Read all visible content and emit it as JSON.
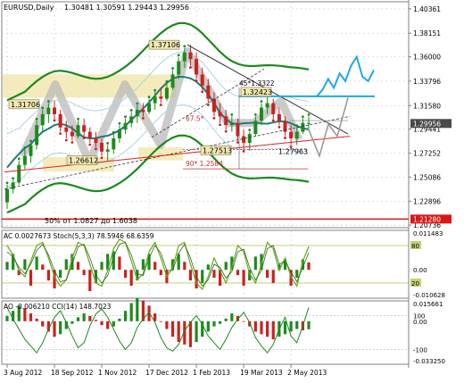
{
  "header": {
    "title": "EURUSD,Daily",
    "ohlc": "1.30481 1.30591 1.29443 1.29956"
  },
  "colors": {
    "background": "#ffffff",
    "grid": "#c0c0c0",
    "bull_candle": "#1e8a1e",
    "bear_candle": "#cc2020",
    "moving_average": "#1f7a78",
    "bollinger_outer": "#1a8a1a",
    "bollinger_inner": "#a8d4e8",
    "forecast": "#1ea9e6",
    "level_line": "#d81818",
    "support_line": "#e02020",
    "label_box": "#f2e7b0",
    "price_box": "#4a4a4a",
    "stoch_main": "#6aa619"
  },
  "annotations": {
    "level_high": "1.37106",
    "level_1_3170": "1.31706",
    "level_1_3242": "1.32423",
    "level_1_2661": "1.26612",
    "level_1_2751": "1.27513",
    "level_1_2796": "1.27963",
    "fib_45": "45*1.3322",
    "fib_67": "67.5*",
    "fib_90": "90* 1.2584",
    "fib_50": "50% от 1.0827 до 1.6038"
  },
  "chart_data": [
    {
      "type": "candlestick",
      "name": "EURUSD,Daily",
      "x_dates": [
        "3 Aug 2012",
        "18 Sep 2012",
        "1 Nov 2012",
        "17 Dec 2012",
        "1 Feb 2013",
        "19 Mar 2013",
        "2 May 2013"
      ],
      "ohlc": [
        [
          1.228,
          1.244,
          1.222,
          1.24
        ],
        [
          1.24,
          1.248,
          1.236,
          1.246
        ],
        [
          1.246,
          1.266,
          1.244,
          1.262
        ],
        [
          1.262,
          1.276,
          1.258,
          1.27
        ],
        [
          1.27,
          1.282,
          1.264,
          1.28
        ],
        [
          1.28,
          1.302,
          1.276,
          1.298
        ],
        [
          1.298,
          1.312,
          1.292,
          1.308
        ],
        [
          1.308,
          1.318,
          1.3,
          1.314
        ],
        [
          1.314,
          1.32,
          1.304,
          1.308
        ],
        [
          1.308,
          1.312,
          1.292,
          1.296
        ],
        [
          1.296,
          1.302,
          1.286,
          1.292
        ],
        [
          1.292,
          1.298,
          1.284,
          1.288
        ],
        [
          1.288,
          1.302,
          1.286,
          1.298
        ],
        [
          1.298,
          1.304,
          1.288,
          1.292
        ],
        [
          1.292,
          1.296,
          1.282,
          1.286
        ],
        [
          1.286,
          1.292,
          1.278,
          1.282
        ],
        [
          1.282,
          1.286,
          1.27,
          1.274
        ],
        [
          1.274,
          1.28,
          1.266,
          1.276
        ],
        [
          1.276,
          1.29,
          1.272,
          1.286
        ],
        [
          1.286,
          1.298,
          1.282,
          1.294
        ],
        [
          1.294,
          1.304,
          1.29,
          1.3
        ],
        [
          1.3,
          1.31,
          1.296,
          1.306
        ],
        [
          1.306,
          1.316,
          1.3,
          1.312
        ],
        [
          1.312,
          1.318,
          1.306,
          1.31
        ],
        [
          1.31,
          1.322,
          1.308,
          1.318
        ],
        [
          1.318,
          1.328,
          1.312,
          1.324
        ],
        [
          1.324,
          1.332,
          1.318,
          1.322
        ],
        [
          1.322,
          1.336,
          1.32,
          1.332
        ],
        [
          1.332,
          1.348,
          1.33,
          1.344
        ],
        [
          1.344,
          1.36,
          1.34,
          1.356
        ],
        [
          1.356,
          1.368,
          1.35,
          1.364
        ],
        [
          1.364,
          1.371,
          1.352,
          1.358
        ],
        [
          1.358,
          1.364,
          1.34,
          1.344
        ],
        [
          1.344,
          1.35,
          1.33,
          1.334
        ],
        [
          1.334,
          1.34,
          1.318,
          1.322
        ],
        [
          1.322,
          1.328,
          1.306,
          1.31
        ],
        [
          1.31,
          1.318,
          1.3,
          1.306
        ],
        [
          1.306,
          1.312,
          1.294,
          1.298
        ],
        [
          1.298,
          1.306,
          1.292,
          1.3
        ],
        [
          1.3,
          1.304,
          1.284,
          1.288
        ],
        [
          1.288,
          1.294,
          1.276,
          1.282
        ],
        [
          1.282,
          1.292,
          1.275,
          1.29
        ],
        [
          1.29,
          1.306,
          1.288,
          1.302
        ],
        [
          1.302,
          1.318,
          1.298,
          1.314
        ],
        [
          1.314,
          1.324,
          1.308,
          1.318
        ],
        [
          1.318,
          1.322,
          1.304,
          1.308
        ],
        [
          1.308,
          1.314,
          1.298,
          1.302
        ],
        [
          1.302,
          1.306,
          1.288,
          1.292
        ],
        [
          1.292,
          1.298,
          1.28,
          1.286
        ],
        [
          1.286,
          1.296,
          1.28,
          1.292
        ],
        [
          1.292,
          1.304,
          1.29,
          1.3
        ],
        [
          1.3,
          1.306,
          1.294,
          1.3
        ]
      ],
      "overlays": [
        {
          "name": "moving average",
          "color": "#1f7a78"
        },
        {
          "name": "bollinger outer",
          "color": "#1a8a1a"
        },
        {
          "name": "bollinger inner",
          "color": "#a8d4e8"
        },
        {
          "name": "forecast",
          "color": "#1ea9e6",
          "values": [
            1.3242,
            1.33,
            1.34,
            1.332,
            1.345,
            1.338,
            1.352,
            1.36,
            1.342,
            1.338,
            1.348
          ]
        }
      ],
      "price_axis": {
        "ticks": [
          "1.40361",
          "1.38151",
          "1.36000",
          "1.33796",
          "1.31580",
          "1.29441",
          "1.27252",
          "1.25086",
          "1.22896",
          "1.20736"
        ],
        "current_price": "1.29956",
        "marked_level": "1.21280",
        "range": [
          1.205,
          1.41
        ]
      },
      "grid": true
    },
    {
      "type": "bar",
      "name": "AC",
      "header": "AC 0.0027673  Stoch(5,3,3) 78.5946 68.6359",
      "values": [
        0.003,
        0.006,
        -0.002,
        0.004,
        -0.006,
        0.005,
        0.002,
        -0.004,
        -0.007,
        -0.003,
        0.004,
        0.006,
        0.003,
        -0.002,
        -0.008,
        -0.005,
        0.003,
        0.006,
        0.007,
        0.005,
        -0.003,
        -0.006,
        -0.004,
        0.004,
        0.006,
        0.003,
        -0.002,
        -0.005,
        0.004,
        0.006,
        0.003,
        -0.004,
        -0.007,
        -0.005,
        0.002,
        -0.003,
        -0.006,
        0.003,
        0.005,
        -0.002,
        -0.006,
        -0.004,
        0.005,
        0.006,
        -0.003,
        -0.005,
        0.002,
        0.004,
        -0.006,
        -0.003,
        0.004,
        0.0028
      ],
      "stoch_main": [
        80,
        65,
        40,
        30,
        55,
        80,
        85,
        60,
        30,
        15,
        25,
        60,
        85,
        80,
        50,
        20,
        15,
        40,
        75,
        90,
        85,
        55,
        25,
        35,
        70,
        85,
        60,
        30,
        45,
        80,
        85,
        50,
        20,
        10,
        30,
        60,
        40,
        20,
        45,
        80,
        70,
        35,
        20,
        50,
        85,
        75,
        40,
        60,
        30,
        15,
        55,
        78.59
      ],
      "stoch_signal": [
        70,
        62,
        45,
        35,
        50,
        72,
        82,
        65,
        40,
        22,
        25,
        50,
        78,
        82,
        60,
        32,
        20,
        32,
        62,
        82,
        85,
        65,
        35,
        32,
        60,
        80,
        68,
        40,
        40,
        68,
        82,
        60,
        30,
        15,
        25,
        50,
        45,
        28,
        38,
        70,
        74,
        45,
        25,
        40,
        75,
        80,
        50,
        55,
        38,
        22,
        45,
        68.64
      ],
      "ylim": [
        -0.0107,
        0.0149
      ],
      "levels": [
        "80",
        "20"
      ],
      "axis_ticks": [
        "0.011483",
        "0.00",
        "-0.010628"
      ]
    },
    {
      "type": "bar",
      "name": "AO",
      "header": "AO -0.006210  CCI(14) 148.7023",
      "values": [
        0.004,
        0.008,
        0.012,
        0.01,
        0.006,
        0.002,
        -0.004,
        -0.008,
        -0.012,
        -0.01,
        -0.006,
        -0.002,
        0.003,
        0.006,
        0.004,
        0.001,
        -0.003,
        -0.006,
        -0.004,
        0.002,
        0.008,
        0.014,
        0.018,
        0.016,
        0.012,
        0.006,
        0.0,
        -0.006,
        -0.012,
        -0.016,
        -0.018,
        -0.02,
        -0.016,
        -0.012,
        -0.008,
        -0.004,
        -0.002,
        0.002,
        0.006,
        0.004,
        0.0,
        -0.004,
        -0.008,
        -0.01,
        -0.012,
        -0.014,
        -0.012,
        -0.01,
        -0.008,
        -0.006,
        -0.007,
        -0.0062
      ],
      "cci": [
        150,
        80,
        20,
        -40,
        -80,
        -120,
        -60,
        20,
        90,
        130,
        60,
        -20,
        -90,
        -60,
        40,
        110,
        140,
        90,
        20,
        -50,
        -100,
        -60,
        30,
        80,
        120,
        60,
        -30,
        -90,
        -110,
        -70,
        10,
        60,
        100,
        50,
        -20,
        -60,
        -100,
        -40,
        30,
        80,
        120,
        60,
        -30,
        -80,
        -120,
        -70,
        20,
        90,
        -20,
        -60,
        40,
        148.7
      ],
      "ylim": [
        -0.0332,
        0.0157
      ],
      "cci_levels": [
        "100",
        "-100"
      ],
      "axis_ticks": [
        "0.015661",
        "100",
        "0.00",
        "-100",
        "-0.033250"
      ]
    }
  ]
}
